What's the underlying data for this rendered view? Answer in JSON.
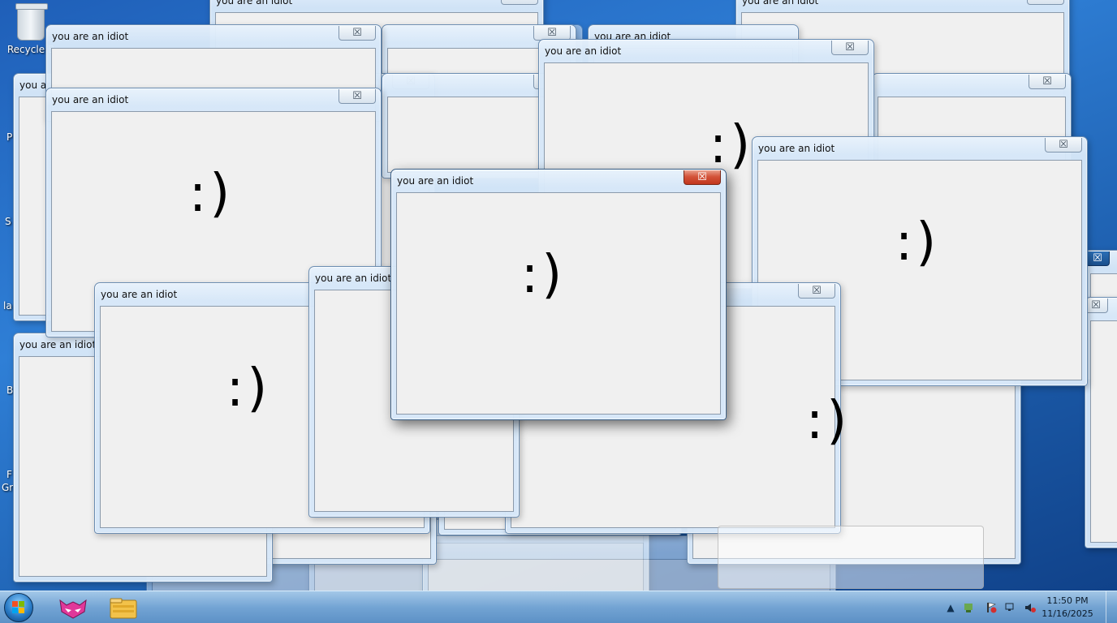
{
  "desktop": {
    "icons": [
      {
        "label": "Recycle B",
        "icon": "recycle-bin-icon"
      }
    ],
    "edge_fragments": [
      "P",
      "S",
      "la",
      "B",
      "F",
      "Gr"
    ]
  },
  "windows": {
    "title": "you are an idiot",
    "close_glyph": "☒",
    "face": ":)"
  },
  "balloon": {
    "title": "",
    "text": ""
  },
  "taskbar": {
    "start_icon": "windows-start-icon",
    "pinned": [
      {
        "icon": "fox-icon",
        "color": "#e0389a"
      },
      {
        "icon": "folder-icon",
        "color": "#f2c24a"
      }
    ],
    "tray": {
      "arrow": "▲",
      "time": "11:50 PM",
      "date": "11/16/2025"
    }
  },
  "colors": {
    "desktop": "#2f7fd6",
    "close_active": "#c9472d"
  }
}
